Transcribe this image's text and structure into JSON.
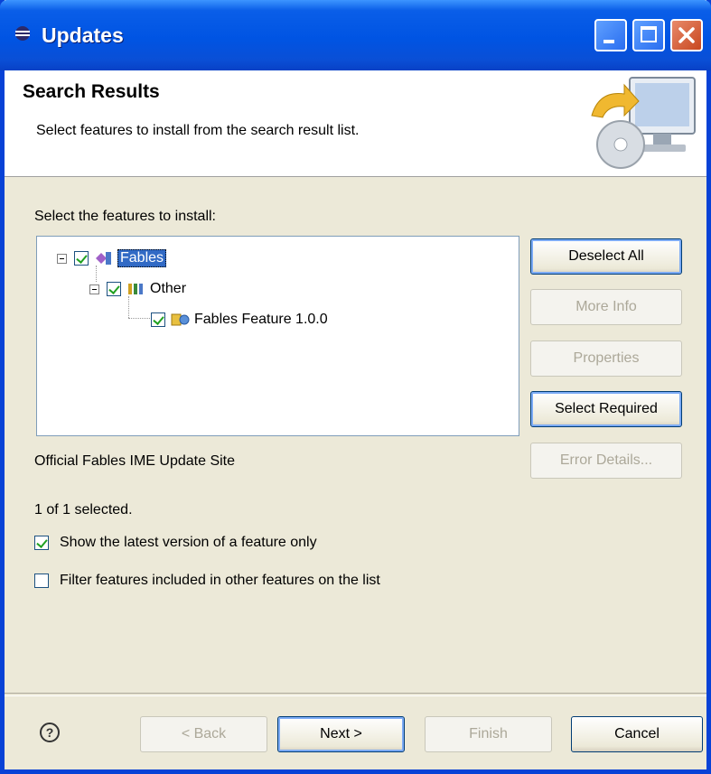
{
  "window": {
    "title": "Updates"
  },
  "banner": {
    "title": "Search Results",
    "description": "Select features to install from the search result list."
  },
  "features": {
    "label": "Select the features to install:",
    "tree": [
      {
        "label": "Fables",
        "checked": true,
        "selected": true
      },
      {
        "label": "Other",
        "checked": true
      },
      {
        "label": "Fables Feature 1.0.0",
        "checked": true
      }
    ]
  },
  "side_buttons": {
    "deselect_all": "Deselect All",
    "more_info": "More Info",
    "properties": "Properties",
    "select_required": "Select Required",
    "error_details": "Error Details..."
  },
  "site_label": "Official Fables IME Update Site",
  "selection_count": "1 of 1 selected.",
  "options": {
    "latest_version": {
      "label": "Show the latest version of a feature only",
      "checked": true
    },
    "filter_included": {
      "label": "Filter features included in other features on the list",
      "checked": false
    }
  },
  "footer": {
    "back": "< Back",
    "next": "Next >",
    "finish": "Finish",
    "cancel": "Cancel",
    "help_symbol": "?"
  },
  "colors": {
    "titlebar": "#0054e3",
    "selection": "#316ac5",
    "window_bg": "#ece9d8"
  }
}
